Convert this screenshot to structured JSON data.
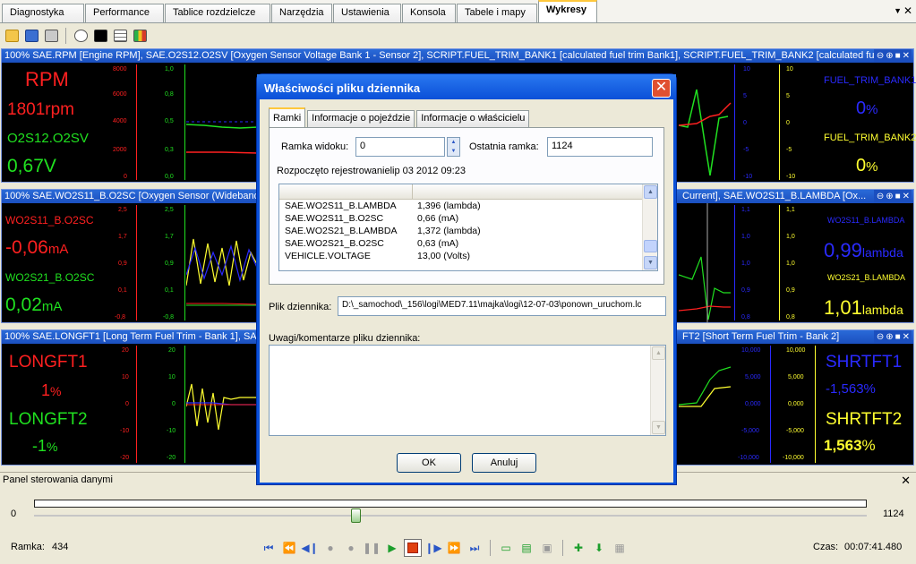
{
  "tabs": [
    "Diagnostyka",
    "Performance",
    "Tablice rozdzielcze",
    "Narzędzia",
    "Ustawienia",
    "Konsola",
    "Tabele i mapy",
    "Wykresy"
  ],
  "toolbar": {
    "icons": [
      "open-folder-icon",
      "save-icon",
      "export-icon",
      "gauge-icon",
      "graph-icon",
      "table-icon",
      "color-grid-icon"
    ]
  },
  "panel1": {
    "title": "100% SAE.RPM [Engine RPM], SAE.O2S12.O2SV [Oxygen Sensor Voltage Bank 1 - Sensor 2], SCRIPT.FUEL_TRIM_BANK1 [calculated fuel trim Bank1], SCRIPT.FUEL_TRIM_BANK2 [calculated fuel tri...",
    "left": {
      "name1": "RPM",
      "value1": "1801",
      "unit1": "rpm",
      "name2": "O2S12.O2SV",
      "value2": "0,67",
      "unit2": "V"
    },
    "right": {
      "name1": "FUEL_TRIM_BANK1",
      "value1": "0",
      "unit1": "%",
      "name2": "FUEL_TRIM_BANK2",
      "value2": "0",
      "unit2": "%"
    },
    "ticks": {
      "rpm": [
        "8000",
        "6000",
        "4000",
        "2000",
        "0"
      ],
      "o2": [
        "1,0",
        "0,8",
        "0,5",
        "0,3",
        "0,0"
      ],
      "ft1": [
        "10",
        "5",
        "0",
        "-5",
        "-10"
      ],
      "ft2": [
        "10",
        "5",
        "0",
        "-5",
        "-10"
      ]
    }
  },
  "panel2": {
    "title": "100% SAE.WO2S11_B.O2SC [Oxygen Sensor (Wideband)",
    "title_right": "Current], SAE.WO2S11_B.LAMBDA [Ox...",
    "left": {
      "name1": "WO2S11_B.O2SC",
      "value1": "-0,06",
      "unit1": "mA",
      "name2": "WO2S21_B.O2SC",
      "value2": "0,02",
      "unit2": "mA"
    },
    "right": {
      "name1": "WO2S11_B.LAMBDA",
      "value1": "0,99",
      "unit1": "lambda",
      "name2": "WO2S21_B.LAMBDA",
      "value2": "1,01",
      "unit2": "lambda"
    },
    "ticks": {
      "a": [
        "2,5",
        "1,7",
        "0,9",
        "0,1",
        "-0,8"
      ],
      "b": [
        "2,5",
        "1,7",
        "0,9",
        "0,1",
        "-0,8"
      ],
      "c": [
        "1,1",
        "1,0",
        "1,0",
        "0,9",
        "0,8"
      ],
      "d": [
        "1,1",
        "1,0",
        "1,0",
        "0,9",
        "0,8"
      ]
    }
  },
  "panel3": {
    "title": "100% SAE.LONGFT1 [Long Term Fuel Trim - Bank 1], SAE.",
    "title_right": "FT2 [Short Term Fuel Trim - Bank 2]",
    "left": {
      "name1": "LONGFT1",
      "value1": "1",
      "unit1": "%",
      "name2": "LONGFT2",
      "value2": "-1",
      "unit2": "%"
    },
    "right": {
      "name1": "SHRTFT1",
      "value1": "-1,563",
      "unit1": "%",
      "name2": "SHRTFT2",
      "value2": "1,563",
      "unit2": "%"
    },
    "ticks": {
      "a": [
        "20",
        "10",
        "0",
        "-10",
        "-20"
      ],
      "b": [
        "20",
        "10",
        "0",
        "-10",
        "-20"
      ],
      "c": [
        "10,000",
        "5,000",
        "0,000",
        "-5,000",
        "-10,000"
      ],
      "d": [
        "10,000",
        "5,000",
        "0,000",
        "-5,000",
        "-10,000"
      ]
    }
  },
  "control_panel": {
    "title": "Panel sterowania danymi",
    "min": "0",
    "max": "1124",
    "position": 0.386,
    "frame_label": "Ramka:",
    "frame_value": "434",
    "time_label": "Czas:",
    "time_value": "00:07:41.480"
  },
  "dialog": {
    "title": "Właściwości pliku dziennika",
    "tabs": [
      "Ramki",
      "Informacje o pojeździe",
      "Informacje o właścicielu"
    ],
    "view_frame_label": "Ramka widoku:",
    "view_frame_value": "0",
    "last_frame_label": "Ostatnia ramka:",
    "last_frame_value": "1124",
    "recording_started": "Rozpoczęto rejestrowanielip 03 2012 09:23",
    "list_rows": [
      {
        "name": "SAE.WO2S11_B.LAMBDA",
        "value": "1,396 (lambda)"
      },
      {
        "name": "SAE.WO2S11_B.O2SC",
        "value": "0,66 (mA)"
      },
      {
        "name": "SAE.WO2S21_B.LAMBDA",
        "value": "1,372 (lambda)"
      },
      {
        "name": "SAE.WO2S21_B.O2SC",
        "value": "0,63 (mA)"
      },
      {
        "name": "VEHICLE.VOLTAGE",
        "value": "13,00 (Volts)"
      }
    ],
    "log_file_label": "Plik dziennika:",
    "log_file_value": "D:\\_samochod\\_156\\logi\\MED7.11\\majka\\logi\\12-07-03\\ponown_uruchom.lc",
    "comments_label": "Uwagi/komentarze pliku dziennika:",
    "ok_label": "OK",
    "cancel_label": "Anuluj"
  },
  "colors": {
    "red": "#ff2020",
    "green": "#20e020",
    "blue": "#2a2aff",
    "yellow": "#ffff30",
    "title_blue": "#1b4fbf"
  }
}
